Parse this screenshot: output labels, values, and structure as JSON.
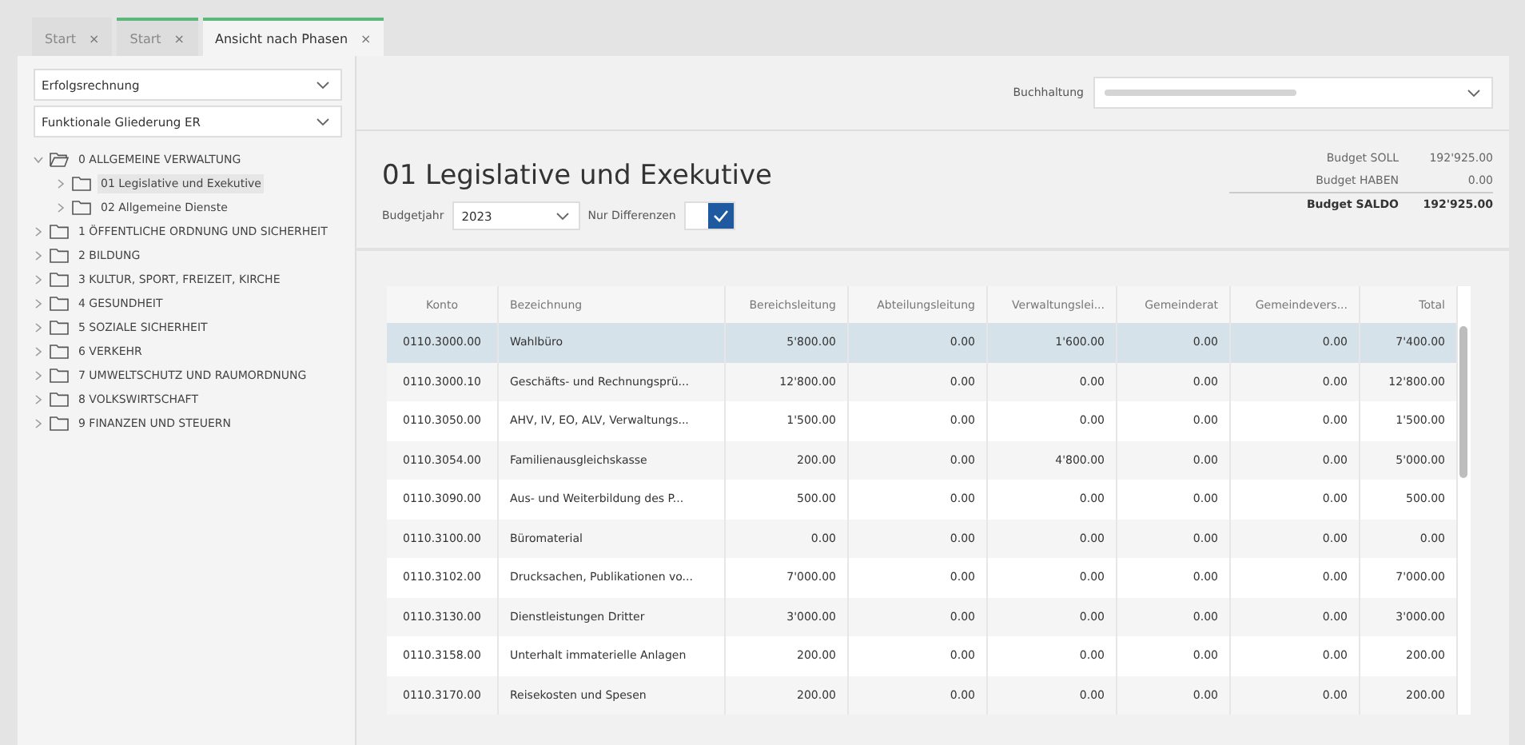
{
  "tabs": [
    {
      "label": "Start",
      "selected": false,
      "marked": false,
      "close": "×"
    },
    {
      "label": "Start",
      "selected": false,
      "marked": true,
      "close": "×"
    },
    {
      "label": "Ansicht nach Phasen",
      "selected": true,
      "marked": true,
      "close": "×"
    }
  ],
  "sidebar": {
    "dropdowns": [
      {
        "value": "Erfolgsrechnung"
      },
      {
        "value": "Funktionale Gliederung ER"
      }
    ],
    "tree": [
      {
        "label": "0 ALLGEMEINE VERWALTUNG",
        "expanded": true,
        "selected": false,
        "children": [
          {
            "label": "01 Legislative und Exekutive",
            "expanded": false,
            "selected": true
          },
          {
            "label": "02 Allgemeine Dienste",
            "expanded": false,
            "selected": false
          }
        ]
      },
      {
        "label": "1 ÖFFENTLICHE ORDNUNG UND SICHERHEIT",
        "expanded": false,
        "selected": false
      },
      {
        "label": "2 BILDUNG",
        "expanded": false,
        "selected": false
      },
      {
        "label": "3 KULTUR, SPORT, FREIZEIT, KIRCHE",
        "expanded": false,
        "selected": false
      },
      {
        "label": "4 GESUNDHEIT",
        "expanded": false,
        "selected": false
      },
      {
        "label": "5 SOZIALE SICHERHEIT",
        "expanded": false,
        "selected": false
      },
      {
        "label": "6 VERKEHR",
        "expanded": false,
        "selected": false
      },
      {
        "label": "7 UMWELTSCHUTZ UND RAUMORDNUNG",
        "expanded": false,
        "selected": false
      },
      {
        "label": "8 VOLKSWIRTSCHAFT",
        "expanded": false,
        "selected": false
      },
      {
        "label": "9 FINANZEN UND STEUERN",
        "expanded": false,
        "selected": false
      }
    ]
  },
  "toolbar": {
    "label": "Buchhaltung"
  },
  "header": {
    "title": "01 Legislative und Exekutive",
    "year_label": "Budgetjahr",
    "year": "2023",
    "diff_label": "Nur Differenzen",
    "diff_checked": true,
    "budget": [
      {
        "label": "Budget SOLL",
        "value": "192'925.00",
        "bold": false
      },
      {
        "label": "Budget HABEN",
        "value": "0.00",
        "bold": false
      },
      {
        "label": "Budget SALDO",
        "value": "192'925.00",
        "bold": true
      }
    ]
  },
  "table": {
    "columns": [
      "Konto",
      "Bezeichnung",
      "Bereichsleitung",
      "Abteilungsleitung",
      "Verwaltungslei...",
      "Gemeinderat",
      "Gemeindevers...",
      "Total"
    ],
    "rows": [
      {
        "selected": true,
        "cells": [
          "0110.3000.00",
          "Wahlbüro",
          "5'800.00",
          "0.00",
          "1'600.00",
          "0.00",
          "0.00",
          "7'400.00"
        ]
      },
      {
        "selected": false,
        "cells": [
          "0110.3000.10",
          "Geschäfts- und Rechnungsprü...",
          "12'800.00",
          "0.00",
          "0.00",
          "0.00",
          "0.00",
          "12'800.00"
        ]
      },
      {
        "selected": false,
        "cells": [
          "0110.3050.00",
          "AHV, IV, EO, ALV, Verwaltungs...",
          "1'500.00",
          "0.00",
          "0.00",
          "0.00",
          "0.00",
          "1'500.00"
        ]
      },
      {
        "selected": false,
        "cells": [
          "0110.3054.00",
          "Familienausgleichskasse",
          "200.00",
          "0.00",
          "4'800.00",
          "0.00",
          "0.00",
          "5'000.00"
        ]
      },
      {
        "selected": false,
        "cells": [
          "0110.3090.00",
          "Aus- und Weiterbildung des P...",
          "500.00",
          "0.00",
          "0.00",
          "0.00",
          "0.00",
          "500.00"
        ]
      },
      {
        "selected": false,
        "cells": [
          "0110.3100.00",
          "Büromaterial",
          "0.00",
          "0.00",
          "0.00",
          "0.00",
          "0.00",
          "0.00"
        ]
      },
      {
        "selected": false,
        "cells": [
          "0110.3102.00",
          "Drucksachen, Publikationen vo...",
          "7'000.00",
          "0.00",
          "0.00",
          "0.00",
          "0.00",
          "7'000.00"
        ]
      },
      {
        "selected": false,
        "cells": [
          "0110.3130.00",
          "Dienstleistungen Dritter",
          "3'000.00",
          "0.00",
          "0.00",
          "0.00",
          "0.00",
          "3'000.00"
        ]
      },
      {
        "selected": false,
        "cells": [
          "0110.3158.00",
          "Unterhalt immaterielle Anlagen",
          "200.00",
          "0.00",
          "0.00",
          "0.00",
          "0.00",
          "200.00"
        ]
      },
      {
        "selected": false,
        "cells": [
          "0110.3170.00",
          "Reisekosten und Spesen",
          "200.00",
          "0.00",
          "0.00",
          "0.00",
          "0.00",
          "200.00"
        ]
      }
    ]
  }
}
